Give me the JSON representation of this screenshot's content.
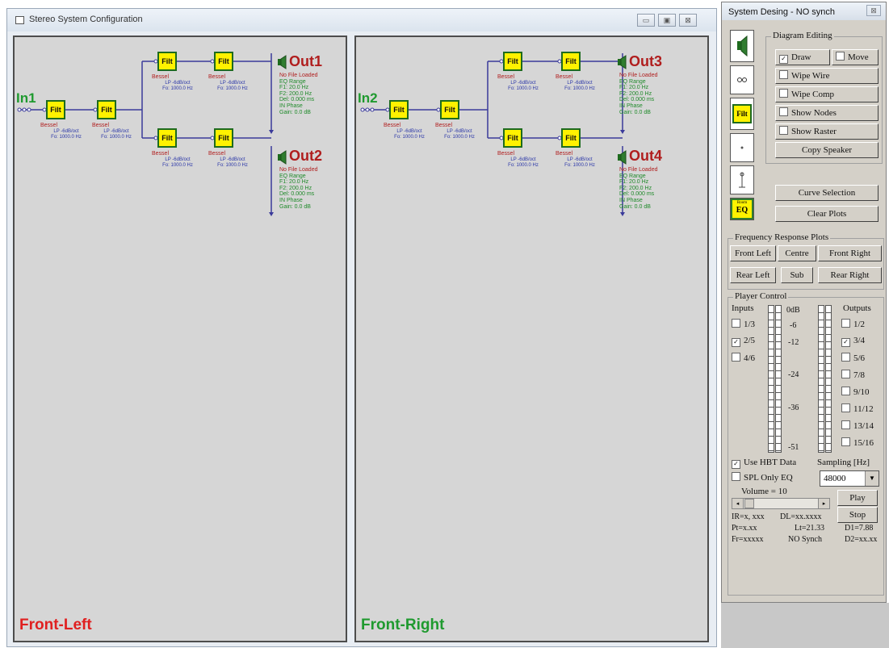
{
  "main_window": {
    "title": "Stereo System Configuration",
    "controls": {
      "minimize": "▭",
      "maximize": "▣",
      "close": "⊠"
    }
  },
  "panels": [
    {
      "name": "Front-Left",
      "name_color": "#e02020",
      "input_label": "In1",
      "outputs": [
        {
          "label": "Out1",
          "file": "No File Loaded",
          "lines": [
            "EQ Range",
            "F1: 20.0 Hz",
            "F2: 200.0 Hz",
            "Del: 0.000 ms",
            "IN Phase",
            "Gain: 0.0 dB"
          ]
        },
        {
          "label": "Out2",
          "file": "No File Loaded",
          "lines": [
            "EQ Range",
            "F1: 20.0 Hz",
            "F2: 200.0 Hz",
            "Del: 0.000 ms",
            "IN Phase",
            "Gain: 0.0 dB"
          ]
        }
      ]
    },
    {
      "name": "Front-Right",
      "name_color": "#1f9a2f",
      "input_label": "In2",
      "outputs": [
        {
          "label": "Out3",
          "file": "No File Loaded",
          "lines": [
            "EQ Range",
            "F1: 20.0 Hz",
            "F2: 200.0 Hz",
            "Del: 0.000 ms",
            "IN Phase",
            "Gain: 0.0 dB"
          ]
        },
        {
          "label": "Out4",
          "file": "No File Loaded",
          "lines": [
            "EQ Range",
            "F1: 20.0 Hz",
            "F2: 200.0 Hz",
            "Del: 0.000 ms",
            "IN Phase",
            "Gain: 0.0 dB"
          ]
        }
      ]
    }
  ],
  "filter_block": {
    "label": "Filt",
    "type": "Bessel",
    "lp": "LP -6dB/oct",
    "fo": "Fo: 1000.0 Hz"
  },
  "side_window": {
    "title": "System Desing - NO synch",
    "close": "⊠",
    "tools": {
      "eq_small": "Room",
      "eq_big": "EQ",
      "filt": "Filt"
    },
    "diagram_editing": {
      "title": "Diagram Editing",
      "draw": "Draw",
      "move": "Move",
      "wipe_wire": "Wipe Wire",
      "wipe_comp": "Wipe Comp",
      "show_nodes": "Show Nodes",
      "show_raster": "Show Raster",
      "copy_speaker": "Copy Speaker"
    },
    "curve_selection": "Curve Selection",
    "clear_plots": "Clear Plots",
    "freq_plots": {
      "title": "Frequency Response Plots",
      "front_left": "Front Left",
      "centre": "Centre",
      "front_right": "Front Right",
      "rear_left": "Rear Left",
      "sub": "Sub",
      "rear_right": "Rear Right"
    },
    "player": {
      "title": "Player Control",
      "inputs_label": "Inputs",
      "outputs_label": "Outputs",
      "inputs": [
        {
          "label": "1/3",
          "checked": false
        },
        {
          "label": "2/5",
          "checked": true
        },
        {
          "label": "4/6",
          "checked": false
        }
      ],
      "outputs": [
        {
          "label": "1/2",
          "checked": false
        },
        {
          "label": "3/4",
          "checked": true
        },
        {
          "label": "5/6",
          "checked": false
        },
        {
          "label": "7/8",
          "checked": false
        },
        {
          "label": "9/10",
          "checked": false
        },
        {
          "label": "11/12",
          "checked": false
        },
        {
          "label": "13/14",
          "checked": false
        },
        {
          "label": "15/16",
          "checked": false
        }
      ],
      "db_scale": [
        "0dB",
        "-6",
        "-12",
        "-24",
        "-36",
        "-51"
      ],
      "use_hbt": "Use HBT Data",
      "spl_only": "SPL Only EQ",
      "sampling_label": "Sampling [Hz]",
      "sampling_value": "48000",
      "volume": "Volume = 10",
      "play": "Play",
      "stop": "Stop",
      "status": {
        "ir": "IR=x, xxx",
        "dl": "DL=xx.xxxx",
        "pt": "Pt=x.xx",
        "lt": "Lt=21.33",
        "d1": "D1=7.88",
        "fr": "Fr=xxxxx",
        "nosync": "NO Synch",
        "d2": "D2=xx.xx"
      }
    }
  }
}
